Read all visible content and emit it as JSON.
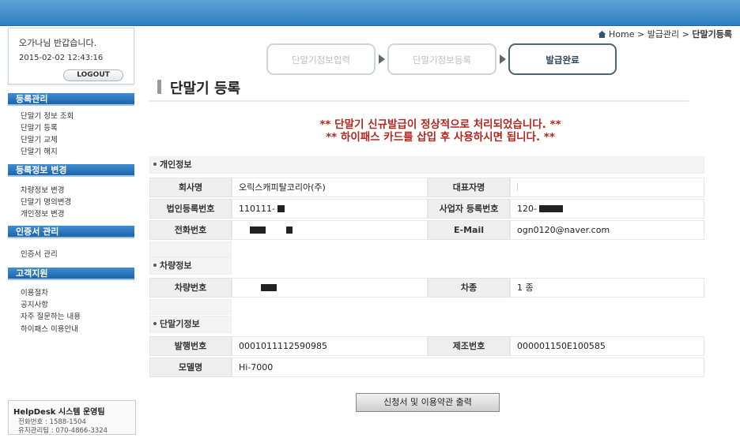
{
  "breadcrumb": {
    "home": "Home",
    "sep": ">",
    "level1": "발급관리",
    "current": "단말기등록"
  },
  "login": {
    "greeting": "오가나님 반갑습니다.",
    "time": "2015-02-02 12:43:16",
    "logout": "LOGOUT"
  },
  "menu": {
    "sections": [
      {
        "title": "등록관리",
        "items": [
          "단말기 정보 조회",
          "단말기 등록",
          "단말기 교체",
          "단말기 해지"
        ]
      },
      {
        "title": "등록정보 변경",
        "items": [
          "차량정보 변경",
          "단말기 명의변경",
          "개인정보 변경"
        ]
      },
      {
        "title": "인증서 관리",
        "items": [
          "인증서 관리"
        ]
      },
      {
        "title": "고객지원",
        "items": [
          "이용절차",
          "공지사항",
          "자주 질문하는 내용",
          "하이패스 이용안내"
        ]
      }
    ]
  },
  "helpdesk": {
    "title": "HelpDesk 시스템 운영팀",
    "line1": "전화번호 : 1588-1504",
    "line2": "유지관리팀 : 070-4866-3324"
  },
  "steps": [
    "단말기정보입력",
    "단말기정보등록",
    "발급완료"
  ],
  "page_title": "단말기 등록",
  "messages": [
    "** 단말기 신규발급이 정상적으로 처리되었습니다. **",
    "** 하이패스 카드를 삽입 후 사용하시면 됩니다. **"
  ],
  "personal": {
    "section": "개인정보",
    "company_label": "회사명",
    "company": "오릭스캐피탈코리아(주)",
    "ceo_label": "대표자명",
    "ceo": "",
    "corp_no_label": "법인등록번호",
    "corp_no": "110111-",
    "biz_no_label": "사업자 등록번호",
    "biz_no": "120-",
    "phone_label": "전화번호",
    "phone": "",
    "email_label": "E-Mail",
    "email": "ogn0120@naver.com"
  },
  "vehicle": {
    "section": "차량정보",
    "plate_label": "차량번호",
    "plate": "",
    "type_label": "차종",
    "type": "1 종"
  },
  "device": {
    "section": "단말기정보",
    "issue_no_label": "발행번호",
    "issue_no": "0001011112590985",
    "serial_label": "제조번호",
    "serial": "000001150E100585",
    "model_label": "모델명",
    "model": "Hi-7000"
  },
  "print_button": "신청서 및 이용약관 출력",
  "colors": {
    "accent": "#2f7ec0",
    "message": "#b3261e"
  }
}
